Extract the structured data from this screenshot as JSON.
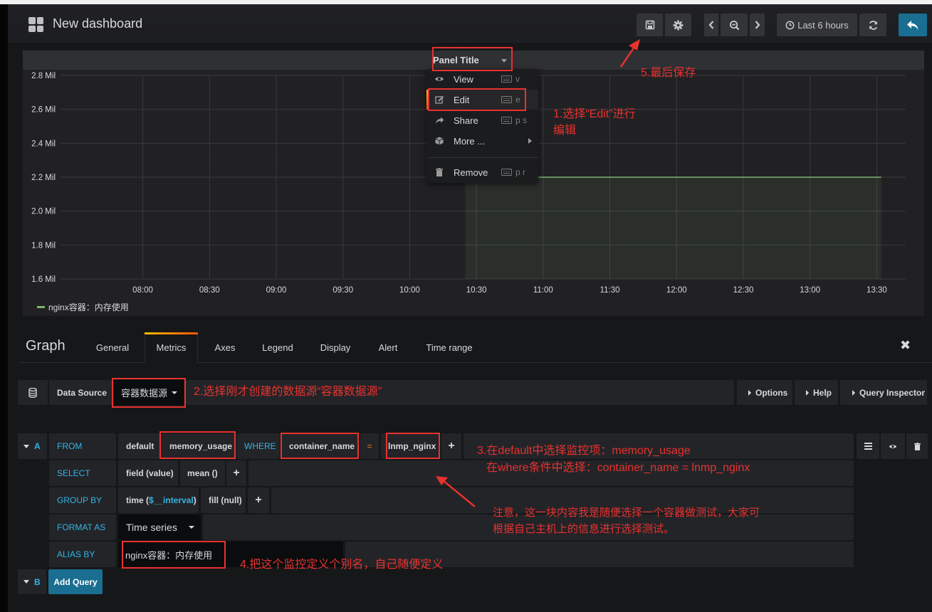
{
  "navbar": {
    "title": "New dashboard",
    "icons": {
      "logo": "dashboard-grid-icon",
      "save": "save-icon",
      "settings": "gear-icon",
      "prev": "chevron-left-icon",
      "zoom_out": "zoom-out-icon",
      "next": "chevron-right-icon",
      "clock": "clock-icon",
      "refresh": "refresh-icon",
      "back": "reply-icon"
    },
    "time_range_label": "Last 6 hours"
  },
  "panel": {
    "title": "Panel Title",
    "menu": [
      {
        "label": "View",
        "shortcut": "v",
        "icon": "eye-icon"
      },
      {
        "label": "Edit",
        "shortcut": "e",
        "icon": "edit-icon",
        "active": true
      },
      {
        "label": "Share",
        "shortcut": "p s",
        "icon": "share-icon"
      },
      {
        "label": "More ...",
        "shortcut": "",
        "icon": "cube-icon",
        "submenu": true
      },
      {
        "label": "Remove",
        "shortcut": "p r",
        "icon": "trash-icon"
      }
    ],
    "legend_label": "nginx容器：内存使用"
  },
  "chart_data": {
    "type": "area",
    "title": "Panel Title",
    "xlabel": "",
    "ylabel": "",
    "y_tick_labels": [
      "2.8 Mil",
      "2.6 Mil",
      "2.4 Mil",
      "2.2 Mil",
      "2.0 Mil",
      "1.8 Mil",
      "1.6 Mil"
    ],
    "y_ticks": [
      2.8,
      2.6,
      2.4,
      2.2,
      2.0,
      1.8,
      1.6
    ],
    "ylim": [
      1.6,
      2.8
    ],
    "y_unit": "Mil",
    "x_tick_labels": [
      "08:00",
      "08:30",
      "09:00",
      "09:30",
      "10:00",
      "10:30",
      "11:00",
      "11:30",
      "12:00",
      "12:30",
      "13:00",
      "13:30"
    ],
    "x_ticks_minutes": [
      480,
      510,
      540,
      570,
      600,
      630,
      660,
      690,
      720,
      750,
      780,
      810
    ],
    "xlim_minutes": [
      443,
      823
    ],
    "grid": true,
    "legend_position": "bottom-left",
    "series": [
      {
        "name": "nginx容器：内存使用",
        "color": "#7eb26d",
        "points": [
          {
            "t": 625,
            "v": 2.2
          },
          {
            "t": 700,
            "v": 2.2
          },
          {
            "t": 780,
            "v": 2.2
          },
          {
            "t": 812,
            "v": 2.2
          }
        ]
      }
    ]
  },
  "editor": {
    "title": "Graph",
    "tabs": [
      "General",
      "Metrics",
      "Axes",
      "Legend",
      "Display",
      "Alert",
      "Time range"
    ],
    "active_tab": "Metrics",
    "close_icon": "close-icon",
    "datasource": {
      "label": "Data Source",
      "value": "容器数据源",
      "icon": "database-icon",
      "options_label": "Options",
      "help_label": "Help",
      "inspector_label": "Query Inspector"
    },
    "query_a": {
      "ref": "A",
      "from_label": "FROM",
      "policy": "default",
      "measurement": "memory_usage",
      "where_label": "WHERE",
      "tag_key": "container_name",
      "operator": "=",
      "tag_value": "lnmp_nginx",
      "select_label": "SELECT",
      "select_field": "field (value)",
      "select_fn": "mean ()",
      "group_label": "GROUP BY",
      "group_time_prefix": "time (",
      "group_time_var": "$__interval",
      "group_time_suffix": ")",
      "group_fill": "fill (null)",
      "format_label": "FORMAT AS",
      "format_value": "Time series",
      "alias_label": "ALIAS BY",
      "alias_value": "nginx容器：内存使用",
      "plus": "+"
    },
    "query_b": {
      "ref": "B",
      "add_label": "Add Query"
    }
  },
  "annotations": {
    "a1_line1": "1.选择“Edit”进行",
    "a1_line2": "编辑",
    "a2": "2.选择刚才创建的数据源“容器数据源”",
    "a3_line1": "3.在default中选择监控项：memory_usage",
    "a3_line2": "在where条件中选择：container_name = lnmp_nginx",
    "a4": "4.把这个监控定义个别名，自己随便定义",
    "a5": "5.最后保存",
    "note_line1": "注意，这一块内容我是随便选择一个容器做测试，大家可",
    "note_line2": "根据自己主机上的信息进行选择测试。"
  }
}
